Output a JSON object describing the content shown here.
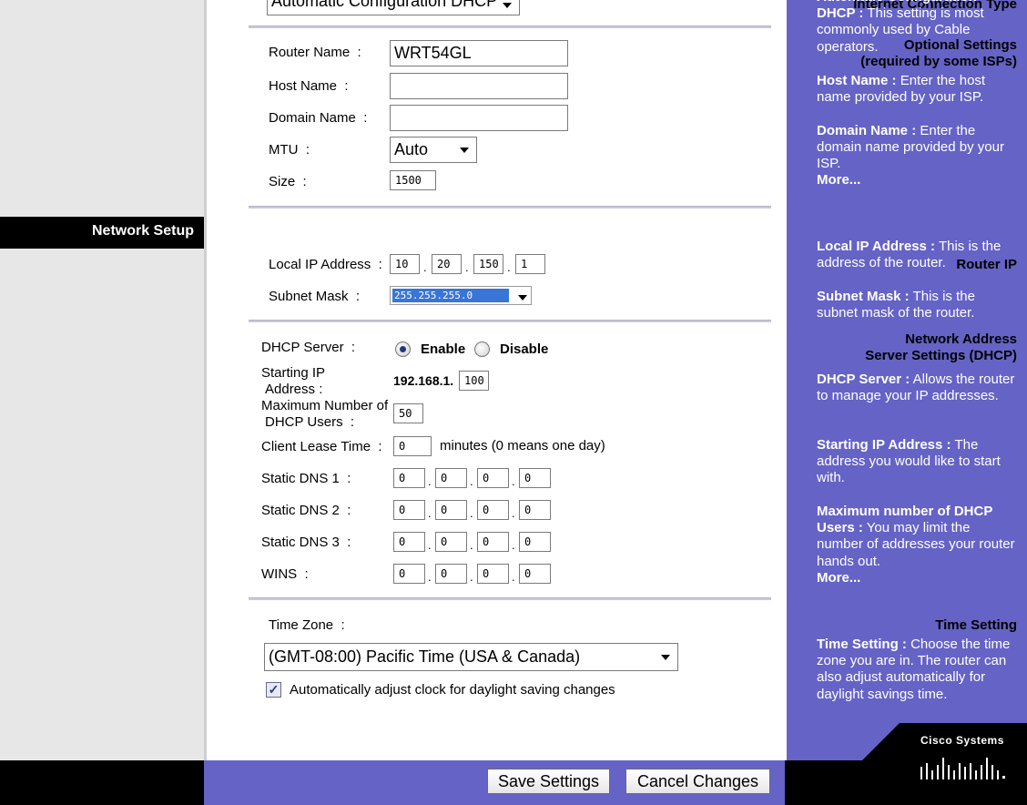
{
  "left": {
    "internet_connection_type": "Internet Connection Type",
    "optional_settings_1": "Optional Settings",
    "optional_settings_2": "(required by some ISPs)",
    "network_setup": "Network Setup",
    "router_ip": "Router IP",
    "dhcp_1": "Network Address",
    "dhcp_2": "Server Settings (DHCP)",
    "time_setting": "Time Setting"
  },
  "connection": {
    "type_value": "Automatic Configuration  DHCP"
  },
  "optional": {
    "router_name_label": "Router Name",
    "router_name_value": "WRT54GL",
    "host_name_label": "Host Name",
    "host_name_value": "",
    "domain_name_label": "Domain Name",
    "domain_name_value": "",
    "mtu_label": "MTU",
    "mtu_value": "Auto",
    "size_label": "Size",
    "size_value": "1500"
  },
  "router_ip": {
    "local_ip_label": "Local IP Address",
    "local_ip": [
      "10",
      "20",
      "150",
      "1"
    ],
    "subnet_label": "Subnet Mask",
    "subnet_value": "255.255.255.0"
  },
  "dhcp": {
    "server_label": "DHCP Server",
    "enable_label": "Enable",
    "disable_label": "Disable",
    "server_enabled": true,
    "start_ip_label_1": "Starting IP",
    "start_ip_label_2": "Address",
    "start_ip_prefix": "192.168.1.",
    "start_ip_value": "100",
    "max_users_label_1": "Maximum Number of",
    "max_users_label_2": "DHCP Users",
    "max_users_value": "50",
    "lease_label": "Client Lease Time",
    "lease_value": "0",
    "lease_suffix": "minutes (0 means one day)",
    "dns1_label": "Static DNS 1",
    "dns1": [
      "0",
      "0",
      "0",
      "0"
    ],
    "dns2_label": "Static DNS 2",
    "dns2": [
      "0",
      "0",
      "0",
      "0"
    ],
    "dns3_label": "Static DNS 3",
    "dns3": [
      "0",
      "0",
      "0",
      "0"
    ],
    "wins_label": "WINS",
    "wins": [
      "0",
      "0",
      "0",
      "0"
    ]
  },
  "time": {
    "zone_label": "Time Zone",
    "zone_value": "(GMT-08:00) Pacific Time (USA & Canada)",
    "dst_label": "Automatically adjust clock for daylight saving changes",
    "dst_checked": true
  },
  "help": {
    "dhcp_title": "Automatic Configuration DHCP :",
    "dhcp_text": "This setting is most commonly used by Cable operators.",
    "host_title": "Host Name :",
    "host_text": "Enter the host name provided by your ISP.",
    "domain_title": "Domain Name :",
    "domain_text": "Enter the domain name provided by your ISP.",
    "more1": "More...",
    "localip_title": "Local IP Address :",
    "localip_text": "This is the address of the router.",
    "subnet_title": "Subnet Mask :",
    "subnet_text": "This is the subnet mask of the router.",
    "dhcpserver_title": "DHCP Server :",
    "dhcpserver_text": "Allows the router to manage your IP addresses.",
    "startip_title": "Starting IP Address :",
    "startip_text": "The address you would like to start with.",
    "maxusers_title": "Maximum number of DHCP Users :",
    "maxusers_text": "You may limit the number of addresses your router hands out.",
    "more2": "More...",
    "time_title": "Time Setting :",
    "time_text": "Choose the time zone you are in. The router can also adjust automatically for daylight savings time."
  },
  "buttons": {
    "save": "Save Settings",
    "cancel": "Cancel Changes"
  },
  "logo": {
    "text": "Cisco Systems"
  },
  "colors": {
    "help_panel": "#6563c6",
    "bottom_bar": "#6563c6",
    "left_panel": "#e7e7e7",
    "selection": "#3875d7"
  }
}
